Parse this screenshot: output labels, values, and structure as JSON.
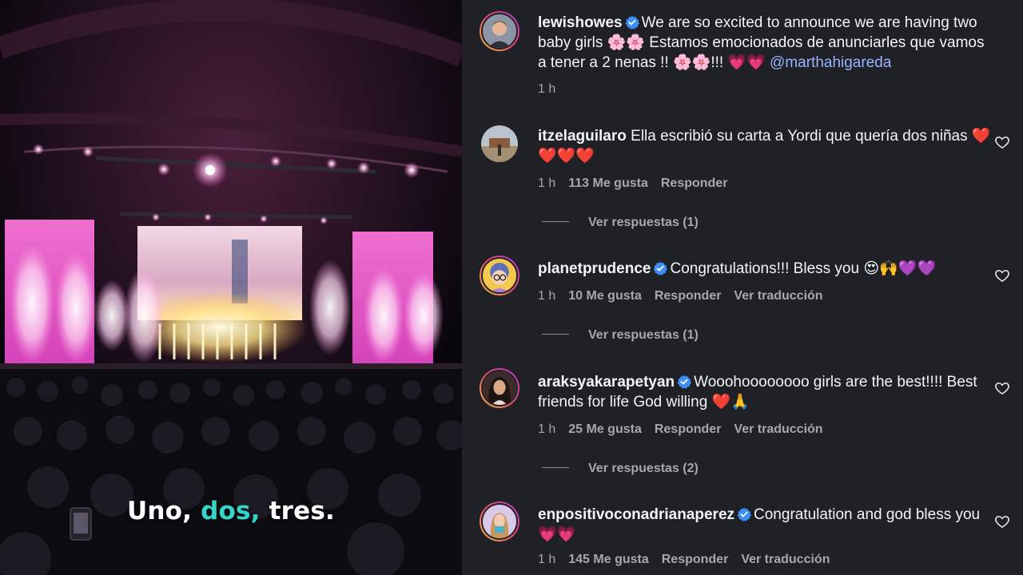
{
  "video": {
    "caption": {
      "word1": "Uno,",
      "word2": "dos,",
      "word3": "tres."
    },
    "colors": {
      "caption_accent": "#33d6c9",
      "stage_pink": "#e14bc4"
    }
  },
  "post": {
    "username": "lewishowes",
    "verified": true,
    "caption": "We are so excited to announce we are having two baby girls 🌸🌸 Estamos emocionados de anunciarles que vamos a tener a 2 nenas !! 🌸🌸!!! 💗💗",
    "mention": "@marthahigareda",
    "time": "1 h"
  },
  "comments": [
    {
      "username": "itzelaguilaro",
      "verified": false,
      "text": "Ella escribió su carta a Yordi que quería dos niñas ❤️❤️❤️❤️",
      "time": "1 h",
      "likes": "113 Me gusta",
      "reply": "Responder",
      "translate": "",
      "view_replies": "Ver respuestas (1)",
      "avatar_icon": "photo-avatar"
    },
    {
      "username": "planetprudence",
      "verified": true,
      "text": "Congratulations!!! Bless you 😍🙌💜💜",
      "time": "1 h",
      "likes": "10 Me gusta",
      "reply": "Responder",
      "translate": "Ver traducción",
      "view_replies": "Ver respuestas (1)",
      "avatar_icon": "cartoon-avatar"
    },
    {
      "username": "araksyakarapetyan",
      "verified": true,
      "text": "Wooohoooooooo girls are the best!!!! Best friends for life God willing ❤️🙏",
      "time": "1 h",
      "likes": "25 Me gusta",
      "reply": "Responder",
      "translate": "Ver traducción",
      "view_replies": "Ver respuestas (2)",
      "avatar_icon": "photo-avatar"
    },
    {
      "username": "enpositivoconadrianaperez",
      "verified": true,
      "text": "Congratulation and god bless you 💗💗",
      "time": "1 h",
      "likes": "145 Me gusta",
      "reply": "Responder",
      "translate": "Ver traducción",
      "view_replies": "",
      "avatar_icon": "photo-avatar"
    }
  ],
  "colors": {
    "panel_bg": "#202127",
    "text": "#f3f4f6",
    "muted": "#a6a8ad",
    "verified_badge": "#3d8ef6",
    "mention": "#98b4ff"
  }
}
